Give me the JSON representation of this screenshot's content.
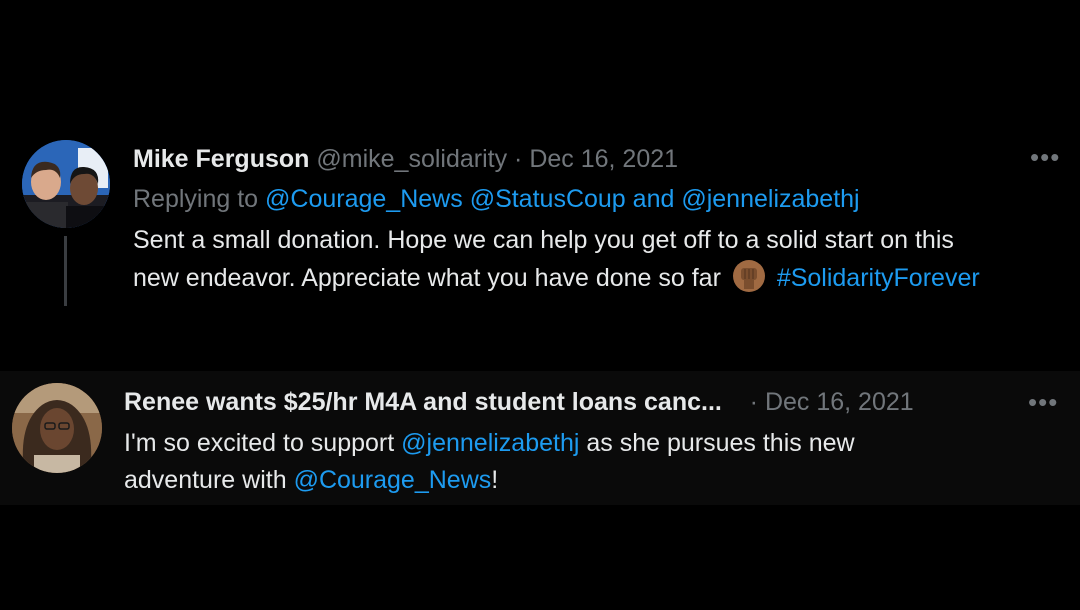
{
  "tweets": [
    {
      "author_name": "Mike Ferguson",
      "handle": "@mike_solidarity",
      "separator": "·",
      "date": "Dec 16, 2021",
      "replying_prefix": "Replying to",
      "replying_mentions": [
        "@Courage_News",
        "@StatusCoup"
      ],
      "replying_and": "and",
      "replying_last": "@jennelizabethj",
      "body_line1": "Sent a small donation. Hope we can help you get off to a solid start on this",
      "body_line2_text": "new endeavor. Appreciate what you have done so far",
      "emoji": "raised-fist-medium-dark-skin-emoji",
      "hashtag": "#SolidarityForever",
      "more": "•••"
    },
    {
      "author_name": "Renee wants $25/hr M4A and student loans canc...",
      "separator": "·",
      "date": "Dec 16, 2021",
      "body_line1_pre": "I'm so excited to support",
      "body_line1_mention": "@jennelizabethj",
      "body_line1_post": "as she pursues this new",
      "body_line2_pre": "adventure with",
      "body_line2_mention": "@Courage_News",
      "body_line2_post": "!",
      "more": "•••"
    }
  ],
  "colors": {
    "background": "#000000",
    "text": "#e7e9ea",
    "muted": "#71767b",
    "link": "#1d9bf0"
  }
}
